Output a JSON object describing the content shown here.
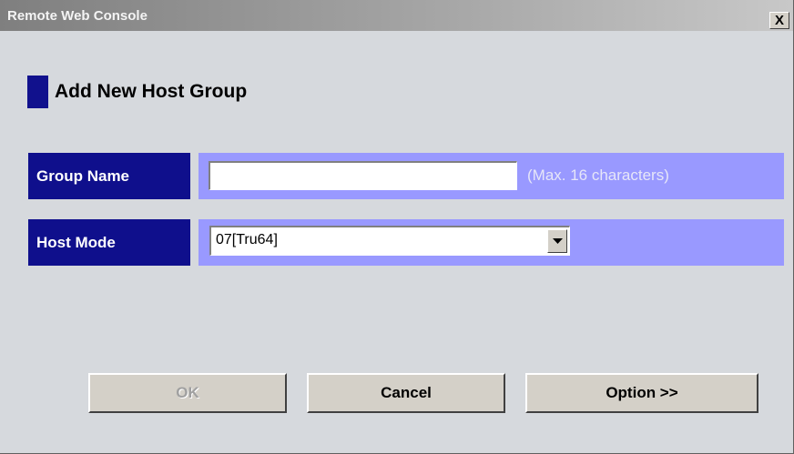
{
  "window": {
    "title": "Remote Web Console",
    "close_label": "X"
  },
  "heading": {
    "text": "Add New Host Group"
  },
  "form": {
    "group_name": {
      "label": "Group Name",
      "value": "",
      "placeholder": "",
      "hint": "(Max. 16 characters)"
    },
    "host_mode": {
      "label": "Host Mode",
      "selected": "07[Tru64]"
    }
  },
  "buttons": {
    "ok": "OK",
    "cancel": "Cancel",
    "option": "Option >>"
  },
  "colors": {
    "label_bg": "#0f0f8c",
    "field_bg": "#9999ff",
    "heading_marker": "#11118d",
    "window_bg": "#d6d9dd"
  }
}
